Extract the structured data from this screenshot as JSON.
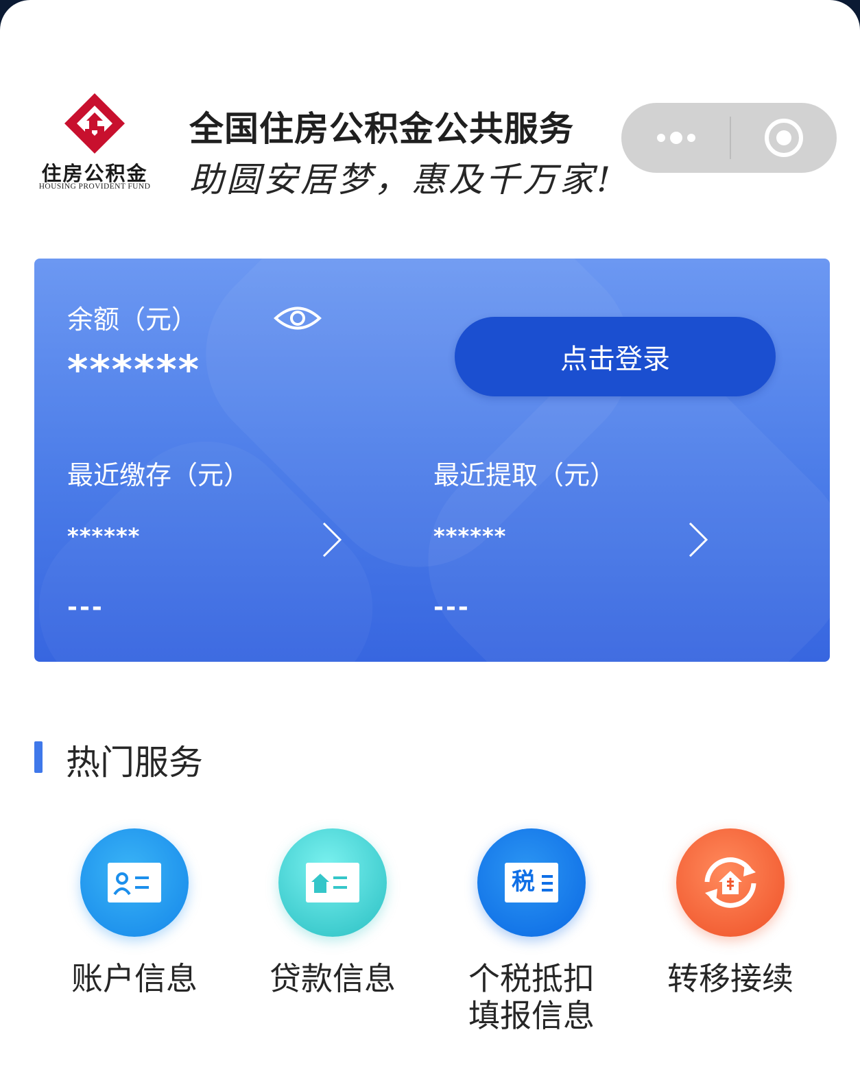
{
  "header": {
    "logo": {
      "cn": "住房公积金",
      "en": "HOUSING  PROVIDENT  FUND"
    },
    "title": "全国住房公积金公共服务",
    "slogan": "助圆安居梦，惠及千万家!",
    "capsule": {
      "more_icon": "more-dots-icon",
      "close_icon": "target-circle-icon"
    }
  },
  "card": {
    "balance_label": "余额（元）",
    "balance_value": "******",
    "eye_icon": "eye-icon",
    "login_button": "点击登录",
    "deposit": {
      "label": "最近缴存（元）",
      "value": "******",
      "date": "---",
      "icon": "chevron-right-icon"
    },
    "withdraw": {
      "label": "最近提取（元）",
      "value": "******",
      "date": "---",
      "icon": "chevron-right-icon"
    }
  },
  "hot_services": {
    "title": "热门服务",
    "items": [
      {
        "label": "账户信息",
        "icon": "account-card-icon",
        "color": "#1c8fec"
      },
      {
        "label": "贷款信息",
        "icon": "loan-card-icon",
        "color": "#35c6c9"
      },
      {
        "label_line1": "个税抵扣",
        "label_line2": "填报信息",
        "icon_text": "税",
        "icon": "tax-card-icon",
        "color": "#0f6fe6"
      },
      {
        "label": "转移接续",
        "icon": "transfer-cycle-icon",
        "color": "#f1592f"
      }
    ]
  },
  "colors": {
    "brand_red": "#c8102e",
    "card_blue": "#4b7ce8",
    "button_blue": "#1b4fd0",
    "accent_bar": "#3f78ea"
  }
}
